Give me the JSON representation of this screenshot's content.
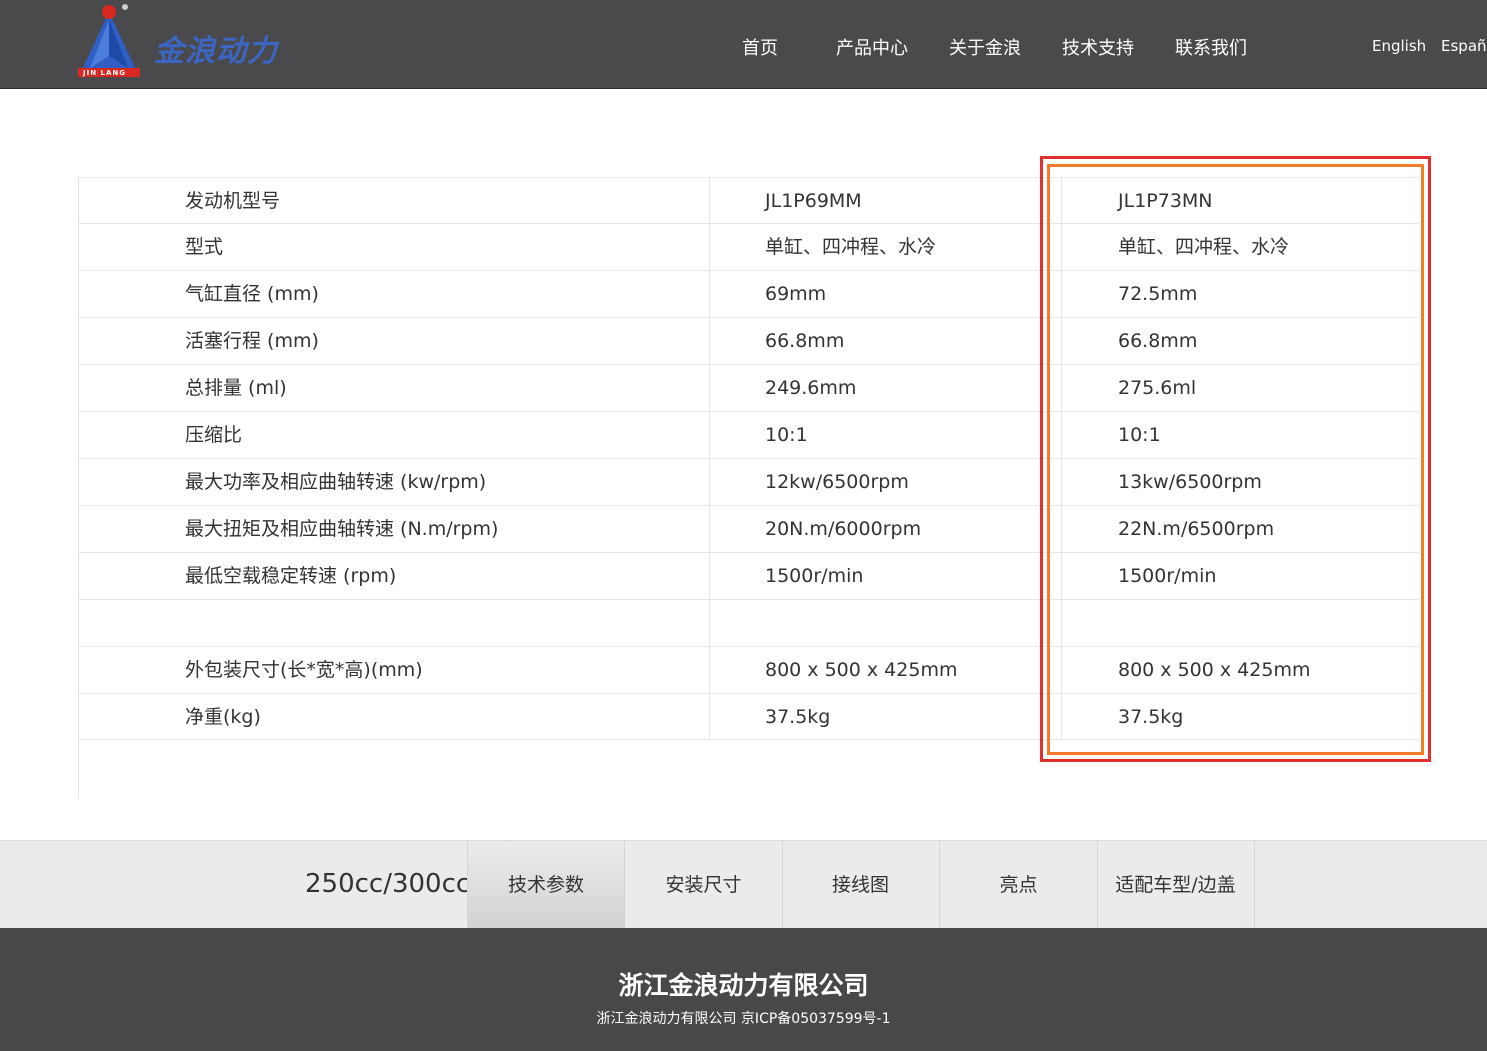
{
  "header": {
    "logo_text": "金浪动力",
    "logo_sub": "JIN LANG",
    "nav": [
      "首页",
      "产品中心",
      "关于金浪",
      "技术支持",
      "联系我们"
    ],
    "languages": [
      "English",
      "Españo"
    ]
  },
  "spec_table": {
    "rows": [
      {
        "label": "发动机型号",
        "v1": "JL1P69MM",
        "v2": "JL1P73MN"
      },
      {
        "label": "型式",
        "v1": "单缸、四冲程、水冷",
        "v2": "单缸、四冲程、水冷"
      },
      {
        "label": "气缸直径 (mm)",
        "v1": "69mm",
        "v2": "72.5mm"
      },
      {
        "label": "活塞行程 (mm)",
        "v1": "66.8mm",
        "v2": "66.8mm"
      },
      {
        "label": "总排量 (ml)",
        "v1": "249.6mm",
        "v2": "275.6ml"
      },
      {
        "label": "压缩比",
        "v1": "10:1",
        "v2": "10:1"
      },
      {
        "label": "最大功率及相应曲轴转速 (kw/rpm)",
        "v1": "12kw/6500rpm",
        "v2": "13kw/6500rpm"
      },
      {
        "label": "最大扭矩及相应曲轴转速 (N.m/rpm)",
        "v1": "20N.m/6000rpm",
        "v2": "22N.m/6500rpm"
      },
      {
        "label": "最低空载稳定转速 (rpm)",
        "v1": "1500r/min",
        "v2": "1500r/min"
      },
      {
        "label": "",
        "v1": "",
        "v2": ""
      },
      {
        "label": "外包装尺寸(长*宽*高)(mm)",
        "v1": "800 x 500 x 425mm",
        "v2": "800 x 500 x 425mm"
      },
      {
        "label": "净重(kg)",
        "v1": "37.5kg",
        "v2": "37.5kg"
      }
    ]
  },
  "highlight": {
    "outer_color": "#e0302f",
    "inner_color": "#f27c2c"
  },
  "tabbar": {
    "title": "250cc/300cc",
    "tabs": [
      "技术参数",
      "安装尺寸",
      "接线图",
      "亮点",
      "适配车型/边盖"
    ],
    "active_tab": "技术参数"
  },
  "footer": {
    "company": "浙江金浪动力有限公司",
    "copyright": "浙江金浪动力有限公司  京ICP备05037599号-1"
  }
}
